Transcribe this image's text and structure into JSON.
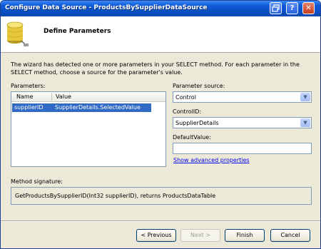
{
  "window": {
    "title": "Configure Data Source - ProductsBySupplierDataSource",
    "controls": [
      "restore-icon",
      "help-icon",
      "close-icon"
    ],
    "help_label": "?",
    "close_label": "✕"
  },
  "header": {
    "title": "Define Parameters",
    "icon": "database-icon"
  },
  "description": "The wizard has detected one or more parameters in your SELECT method. For each parameter in the SELECT method, choose a source for the parameter's value.",
  "parameters": {
    "label": "Parameters:",
    "columns": [
      "Name",
      "Value"
    ],
    "rows": [
      {
        "name": "supplierID",
        "value": "SupplierDetails.SelectedValue",
        "selected": true
      }
    ]
  },
  "parameter_source": {
    "label": "Parameter source:",
    "value": "Control"
  },
  "control_id": {
    "label": "ControlID:",
    "value": "SupplierDetails"
  },
  "default_value": {
    "label": "DefaultValue:",
    "value": ""
  },
  "advanced_link": "Show advanced properties",
  "method_signature": {
    "label": "Method signature:",
    "value": "GetProductsBySupplierID(Int32 supplierID), returns ProductsDataTable"
  },
  "buttons": {
    "previous": "< Previous",
    "next": "Next >",
    "finish": "Finish",
    "cancel": "Cancel"
  },
  "colors": {
    "titlebar": "#0a4fc4",
    "selection": "#316ac5",
    "link": "#0000ee",
    "dialog_bg": "#ece9d8"
  }
}
